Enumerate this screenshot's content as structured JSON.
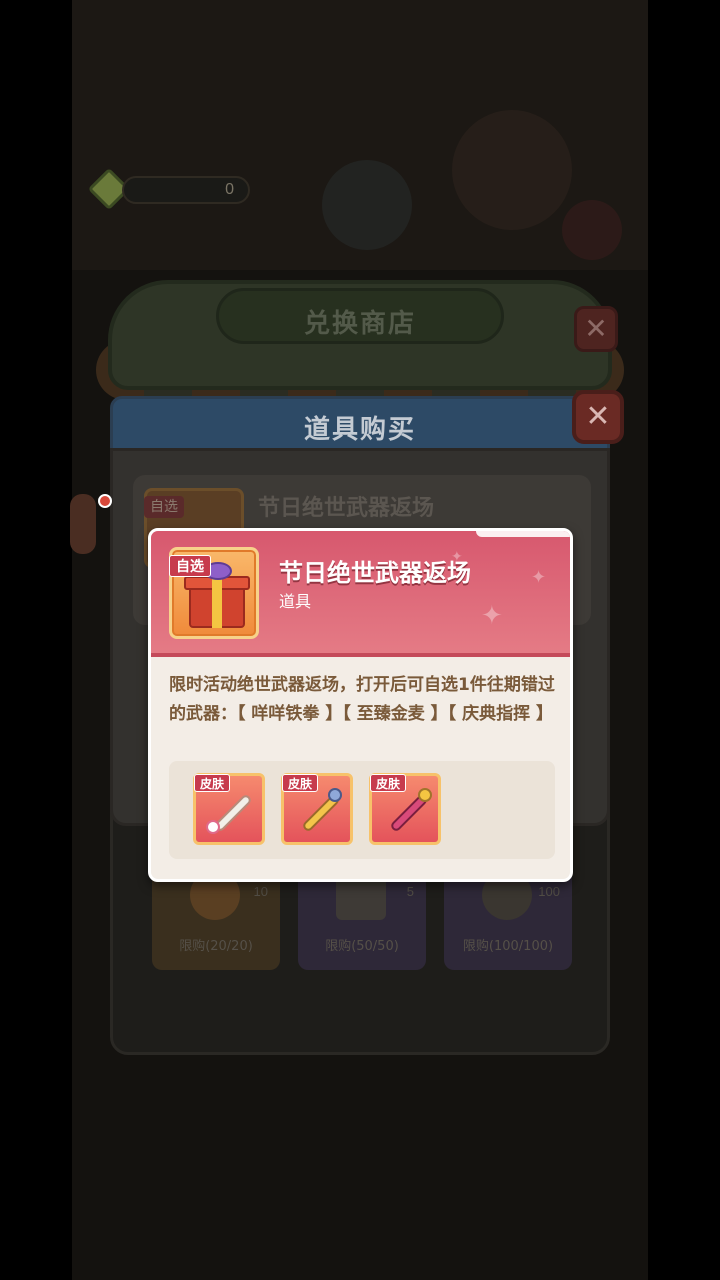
{
  "hud": {
    "currency_count": "0"
  },
  "shop": {
    "title": "兑换商店",
    "close_glyph": "✕",
    "items": [
      {
        "count": "10",
        "limit": "限购(20/20)"
      },
      {
        "count": "5",
        "limit": "限购(50/50)"
      },
      {
        "count": "100",
        "limit": "限购(100/100)"
      }
    ]
  },
  "purchase": {
    "title": "道具购买",
    "close_glyph": "✕",
    "item_badge": "自选",
    "item_name": "节日绝世武器返场"
  },
  "tooltip": {
    "badge": "自选",
    "name": "节日绝世武器返场",
    "type": "道具",
    "description": "限时活动绝世武器返场，打开后可自选1件往期错过的武器：【 咩咩铁拳 】【 至臻金麦 】【 庆典指挥 】",
    "skins": [
      {
        "badge": "皮肤",
        "icon": "sheep-fist-weapon-icon"
      },
      {
        "badge": "皮肤",
        "icon": "golden-wheat-weapon-icon"
      },
      {
        "badge": "皮肤",
        "icon": "celebration-baton-weapon-icon"
      }
    ]
  },
  "colors": {
    "tooltip_header": "#d7586e",
    "badge_red": "#c73b4d",
    "description_text": "#7a5a3a"
  }
}
